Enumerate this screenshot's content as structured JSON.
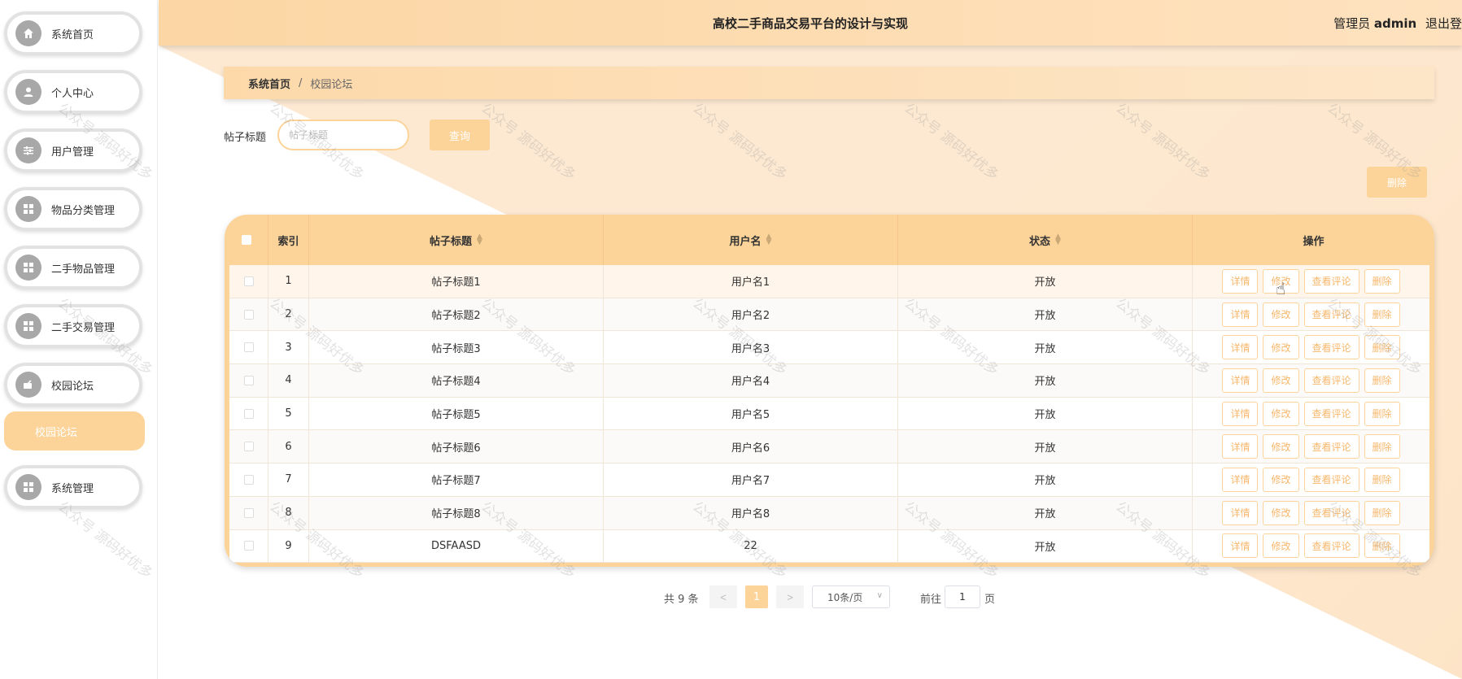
{
  "header": {
    "title": "高校二手商品交易平台的设计与实现",
    "role": "管理员",
    "user": "admin",
    "logout": "退出登"
  },
  "sidebar": {
    "items": [
      {
        "label": "系统首页",
        "icon": "home-icon"
      },
      {
        "label": "个人中心",
        "icon": "user-icon"
      },
      {
        "label": "用户管理",
        "icon": "sliders-icon"
      },
      {
        "label": "物品分类管理",
        "icon": "grid-icon"
      },
      {
        "label": "二手物品管理",
        "icon": "grid-icon"
      },
      {
        "label": "二手交易管理",
        "icon": "grid-icon"
      },
      {
        "label": "校园论坛",
        "icon": "forum-icon"
      },
      {
        "label": "系统管理",
        "icon": "grid-icon"
      }
    ],
    "active_sub": "校园论坛"
  },
  "breadcrumb": {
    "home": "系统首页",
    "separator": "/",
    "current": "校园论坛"
  },
  "search": {
    "label": "帖子标题",
    "placeholder": "帖子标题",
    "value": "",
    "query_button": "查询"
  },
  "delete_button": "删除",
  "table": {
    "columns": [
      "索引",
      "帖子标题",
      "用户名",
      "状态",
      "操作"
    ],
    "rows": [
      {
        "index": "1",
        "title": "帖子标题1",
        "user": "用户名1",
        "status": "开放"
      },
      {
        "index": "2",
        "title": "帖子标题2",
        "user": "用户名2",
        "status": "开放"
      },
      {
        "index": "3",
        "title": "帖子标题3",
        "user": "用户名3",
        "status": "开放"
      },
      {
        "index": "4",
        "title": "帖子标题4",
        "user": "用户名4",
        "status": "开放"
      },
      {
        "index": "5",
        "title": "帖子标题5",
        "user": "用户名5",
        "status": "开放"
      },
      {
        "index": "6",
        "title": "帖子标题6",
        "user": "用户名6",
        "status": "开放"
      },
      {
        "index": "7",
        "title": "帖子标题7",
        "user": "用户名7",
        "status": "开放"
      },
      {
        "index": "8",
        "title": "帖子标题8",
        "user": "用户名8",
        "status": "开放"
      },
      {
        "index": "9",
        "title": "DSFAASD",
        "user": "22",
        "status": "开放"
      }
    ],
    "actions": [
      "详情",
      "修改",
      "查看评论",
      "删除"
    ]
  },
  "pagination": {
    "total": "共 9 条",
    "prev": "<",
    "next": ">",
    "current": "1",
    "page_size": "10条/页",
    "goto_label": "前往",
    "goto_value": "1",
    "page_suffix": "页"
  },
  "watermark": "公众号 源码好优多",
  "colors": {
    "accent": "#fcd49a",
    "header": "#fcd6a4",
    "icon_bg": "#a8a8a8",
    "action_text": "#f7b76b"
  }
}
